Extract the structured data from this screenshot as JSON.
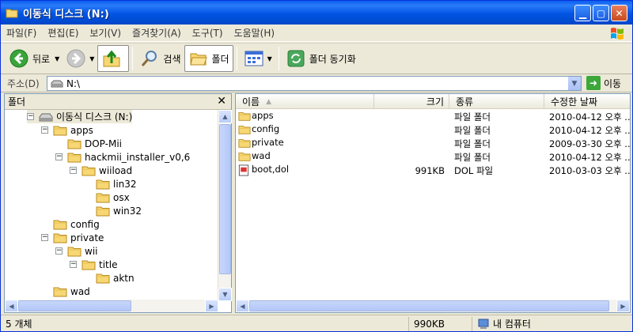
{
  "window": {
    "title": "이동식 디스크 (N:)"
  },
  "menu": [
    "파일(F)",
    "편집(E)",
    "보기(V)",
    "즐겨찾기(A)",
    "도구(T)",
    "도움말(H)"
  ],
  "toolbar": {
    "back": "뒤로",
    "search": "검색",
    "folders": "폴더",
    "sync": "폴더 동기화"
  },
  "address": {
    "label": "주소(D)",
    "value": "N:\\",
    "go": "이동"
  },
  "folder_pane": {
    "title": "폴더",
    "tree": [
      {
        "label": "이동식 디스크 (N:)",
        "level": 0,
        "toggle": "−",
        "kind": "drive"
      },
      {
        "label": "apps",
        "level": 1,
        "toggle": "−"
      },
      {
        "label": "DOP-Mii",
        "level": 2,
        "toggle": ""
      },
      {
        "label": "hackmii_installer_v0,6",
        "level": 2,
        "toggle": "−"
      },
      {
        "label": "wiiload",
        "level": 3,
        "toggle": "−"
      },
      {
        "label": "lin32",
        "level": 4,
        "toggle": ""
      },
      {
        "label": "osx",
        "level": 4,
        "toggle": ""
      },
      {
        "label": "win32",
        "level": 4,
        "toggle": ""
      },
      {
        "label": "config",
        "level": 1,
        "toggle": ""
      },
      {
        "label": "private",
        "level": 1,
        "toggle": "−"
      },
      {
        "label": "wii",
        "level": 2,
        "toggle": "−"
      },
      {
        "label": "title",
        "level": 3,
        "toggle": "−"
      },
      {
        "label": "aktn",
        "level": 4,
        "toggle": ""
      },
      {
        "label": "wad",
        "level": 1,
        "toggle": ""
      }
    ]
  },
  "file_pane": {
    "columns": {
      "name": "이름",
      "size": "크기",
      "type": "종류",
      "modified": "수정한 날짜"
    },
    "rows": [
      {
        "name": "apps",
        "size": "",
        "type": "파일 폴더",
        "modified": "2010-04-12 오후 ...",
        "kind": "folder"
      },
      {
        "name": "config",
        "size": "",
        "type": "파일 폴더",
        "modified": "2010-04-12 오후 ...",
        "kind": "folder"
      },
      {
        "name": "private",
        "size": "",
        "type": "파일 폴더",
        "modified": "2009-03-30 오후 ...",
        "kind": "folder"
      },
      {
        "name": "wad",
        "size": "",
        "type": "파일 폴더",
        "modified": "2010-04-12 오후 ...",
        "kind": "folder"
      },
      {
        "name": "boot,dol",
        "size": "991KB",
        "type": "DOL 파일",
        "modified": "2010-03-03 오후 ...",
        "kind": "file"
      }
    ]
  },
  "status": {
    "count": "5 개체",
    "size": "990KB",
    "location": "내 컴퓨터"
  }
}
